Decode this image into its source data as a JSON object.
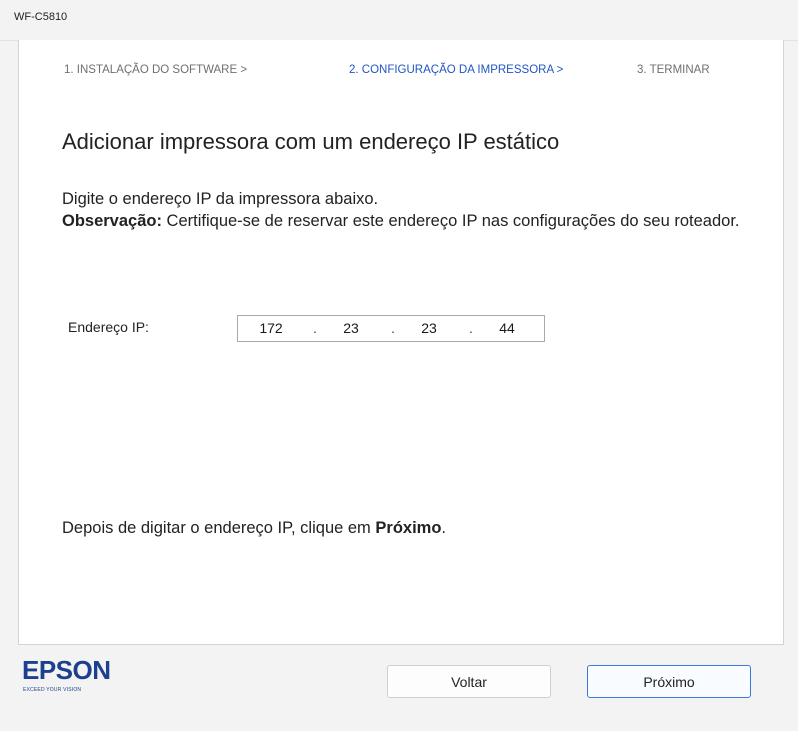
{
  "window": {
    "title": "WF-C5810"
  },
  "steps": [
    {
      "label": "1. INSTALAÇÃO DO SOFTWARE >",
      "active": false
    },
    {
      "label": "2. CONFIGURAÇÃO DA IMPRESSORA >",
      "active": true
    },
    {
      "label": "3. TERMINAR",
      "active": false
    }
  ],
  "content": {
    "heading": "Adicionar impressora com um endereço IP estático",
    "instruction": "Digite o endereço IP da impressora abaixo.",
    "note_label": "Observação:",
    "note_text": " Certifique-se de reservar este endereço IP nas configurações do seu roteador.",
    "ip_label": "Endereço IP:",
    "ip_segments": [
      "172",
      "23",
      "23",
      "44"
    ],
    "ip_separator": ".",
    "final_prefix": "Depois de digitar o endereço IP, clique em ",
    "final_bold": "Próximo",
    "final_suffix": "."
  },
  "footer": {
    "logo_word": "EPSON",
    "logo_tagline": "EXCEED YOUR VISION",
    "back_button": "Voltar",
    "next_button": "Próximo"
  },
  "colors": {
    "active_step": "#2155c4",
    "brand": "#1d3f8f",
    "primary_button_border": "#3b7bd8"
  }
}
